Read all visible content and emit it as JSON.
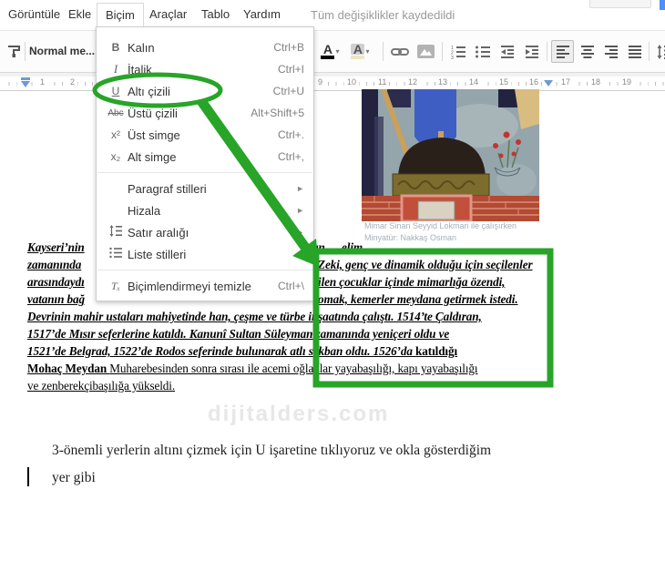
{
  "menubar": {
    "items": [
      {
        "label": "Görüntüle"
      },
      {
        "label": "Ekle"
      },
      {
        "label": "Biçim"
      },
      {
        "label": "Araçlar"
      },
      {
        "label": "Tablo"
      },
      {
        "label": "Yardım"
      }
    ],
    "active_item": "Biçim",
    "status": "Tüm değişiklikler kaydedildi"
  },
  "toolbar": {
    "style_dropdown": "Normal me...",
    "text_color_label": "A",
    "highlight_label": "A",
    "icons": [
      "paint-format-icon",
      "text-color-icon",
      "highlight-color-icon",
      "insert-link-icon",
      "insert-image-icon",
      "numbered-list-icon",
      "bullet-list-icon",
      "outdent-icon",
      "indent-icon",
      "align-left-icon",
      "align-center-icon",
      "align-right-icon",
      "justify-icon",
      "line-spacing-icon"
    ],
    "selected_alignment": "align-left"
  },
  "format_menu": {
    "submenu_arrow": "►",
    "items": [
      {
        "glyph": "B",
        "label": "Kalın",
        "shortcut": "Ctrl+B"
      },
      {
        "glyph": "I",
        "label": "İtalik",
        "shortcut": "Ctrl+I"
      },
      {
        "glyph": "U",
        "label": "Altı çizili",
        "shortcut": "Ctrl+U"
      },
      {
        "glyph": "Abc",
        "label": "Üstü çizili",
        "shortcut": "Alt+Shift+5"
      },
      {
        "glyph": "x²",
        "label": "Üst simge",
        "shortcut": "Ctrl+."
      },
      {
        "glyph": "x₂",
        "label": "Alt simge",
        "shortcut": "Ctrl+,"
      },
      {
        "label": "Paragraf stilleri"
      },
      {
        "label": "Hizala"
      },
      {
        "label": "Satır aralığı"
      },
      {
        "label": "Liste stilleri"
      },
      {
        "glyph": "Tₓ",
        "label": "Biçimlendirmeyi temizle",
        "shortcut": "Ctrl+\\"
      }
    ]
  },
  "ruler": {
    "numbers": [
      "1",
      "2",
      "9",
      "10",
      "11",
      "12",
      "13",
      "14",
      "15",
      "16",
      "17",
      "18",
      "19"
    ]
  },
  "document": {
    "image_caption_line1": "Mimar Sinan Seyyid Lokman ile çalışırken",
    "image_caption_line2": "Minyatür: Nakkaş Osman",
    "paragraph1": {
      "l1_left": "Kayseri’nin",
      "l1_right_a": "an",
      "l1_right_b": "elim",
      "l2_left": "zamanında",
      "l2_right": "Zeki, genç ve dinamik olduğu için seçilenler",
      "l3_left": "arasındaydı",
      "l3_right": "ilen çocuklar içinde mimarlığa özendi,",
      "l4_left": "vatanın bağ",
      "l4_right": "omak, kemerler meydana getirmek istedi.",
      "l5": "Devrinin mahir ustaları mahiyetinde han, çeşme ve türbe inşaatında çalıştı. 1514’te Çaldıran,",
      "l6": "1517’de Mısır seferlerine katıldı. Kanunî Sultan Süleyman zamanında yeniçeri oldu ve",
      "l7a": "1521’de Belgrad, 1522’de Rodos seferinde bulunarak atlı sekban oldu. 1526’da ",
      "l7b": "katıldığı",
      "l8a": "Mohaç Meydan ",
      "l8b": "Muharebesinden sonra sırası ile acemi oğlanlar yayabaşılığı, kapı yayabaşılığı",
      "l9": "ve zenberekçibaşılığa yükseldi."
    },
    "watermark": "dijitalders.com",
    "paragraph2_line1": "3-önemli yerlerin altını çizmek için U işaretine tıklıyoruz ve okla gösterdiğim",
    "paragraph2_line2": "yer gibi"
  },
  "annotations": {
    "circled_menu_item": "Altı çizili",
    "color": "#28a428"
  },
  "colors": {
    "annotation_green": "#28a428",
    "accent_blue": "#4d90fe",
    "marker_blue": "#6d9ad4"
  }
}
